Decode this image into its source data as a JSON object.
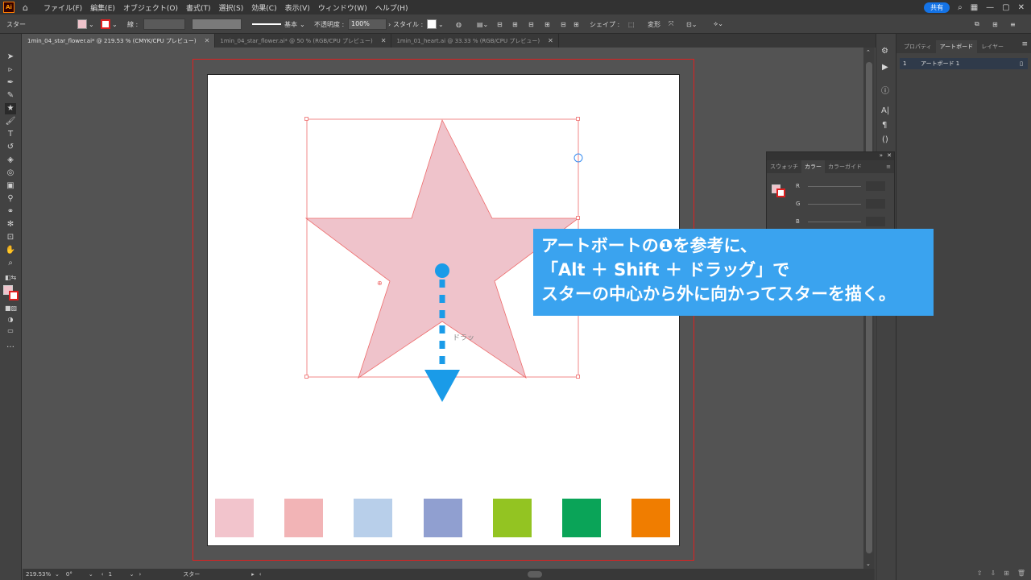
{
  "menubar": {
    "logo": "Ai",
    "items": [
      "ファイル(F)",
      "編集(E)",
      "オブジェクト(O)",
      "書式(T)",
      "選択(S)",
      "効果(C)",
      "表示(V)",
      "ウィンドウ(W)",
      "ヘルプ(H)"
    ],
    "share_label": "共有"
  },
  "controlbar": {
    "object_type": "スター",
    "stroke_label": "線 :",
    "brush_label": "基本",
    "opacity_label": "不透明度 :",
    "opacity_value": "100%",
    "style_label": "スタイル :",
    "shape_label": "シェイプ :",
    "transform_label": "変形"
  },
  "tabs": [
    {
      "label": "1min_04_star_flower.ai* @ 219.53 % (CMYK/CPU プレビュー)",
      "active": true
    },
    {
      "label": "1min_04_star_flower.ai* @ 50 % (RGB/CPU プレビュー)",
      "active": false
    },
    {
      "label": "1min_01_heart.ai @ 33.33 % (RGB/CPU プレビュー)",
      "active": false
    }
  ],
  "right_panel": {
    "tabs": [
      "プロパティ",
      "アートボード",
      "レイヤー"
    ],
    "active_tab": "アートボード",
    "artboards": [
      {
        "index": "1",
        "name": "アートボード 1"
      }
    ]
  },
  "color_panel": {
    "tabs": [
      "スウォッチ",
      "カラー",
      "カラーガイド"
    ],
    "active_tab": "カラー",
    "channels": [
      "R",
      "G",
      "B"
    ]
  },
  "callout": {
    "line1": "アートボートの❶を参考に、",
    "line2": "「Alt ＋ Shift ＋ ドラッグ」で",
    "line3": "スターの中心から外に向かってスターを描く。"
  },
  "canvas": {
    "drag_hint": "ドラッ",
    "star_fill": "#efc3cb",
    "arrow_color": "#1a9be8"
  },
  "swatches": [
    "#f2c4cc",
    "#f2b4b6",
    "#b8cfea",
    "#909fd0",
    "#93c422",
    "#0aa458",
    "#f07d00"
  ],
  "statusbar": {
    "zoom": "219.53%",
    "rotation": "0°",
    "artboard_number": "1",
    "tool_name": "スター"
  }
}
